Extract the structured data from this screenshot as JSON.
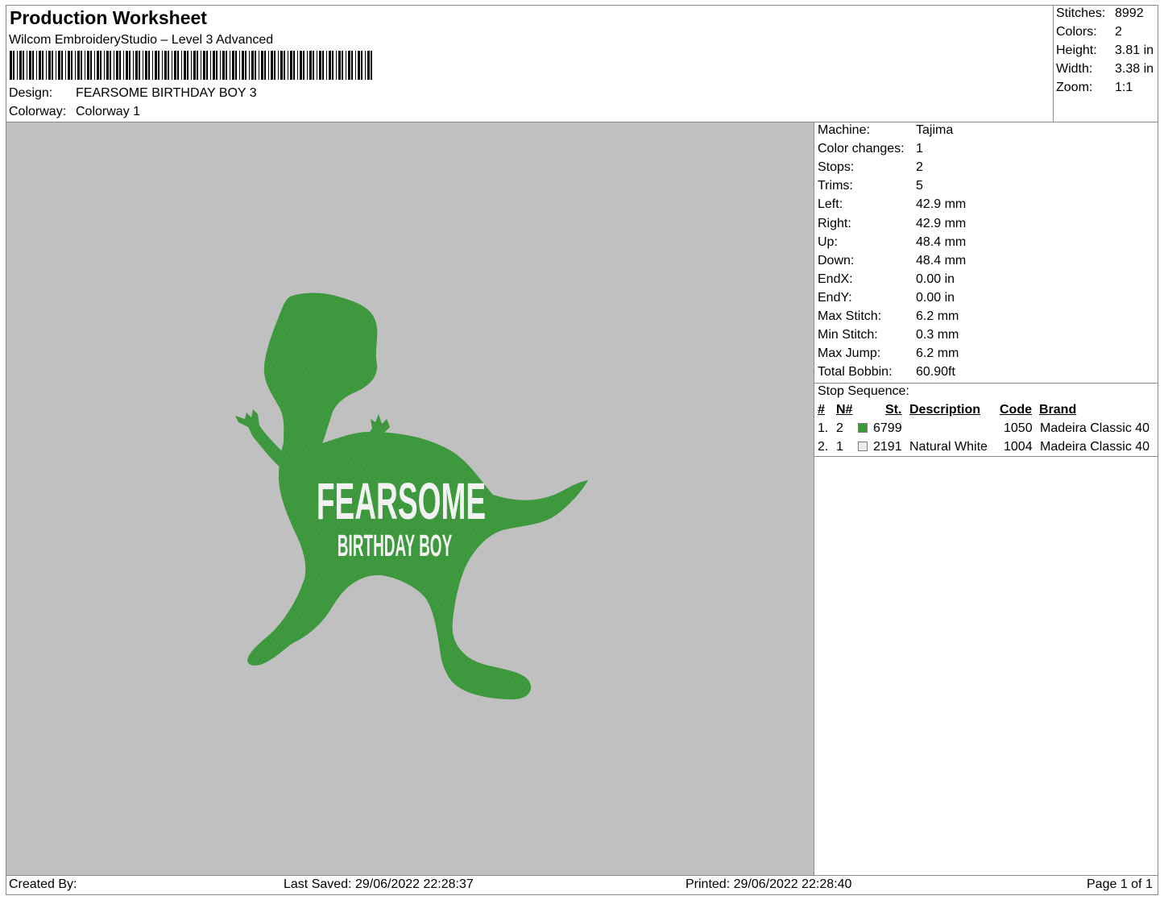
{
  "header": {
    "title": "Production Worksheet",
    "software": "Wilcom EmbroideryStudio – Level 3 Advanced",
    "design_label": "Design:",
    "design_value": "FEARSOME BIRTHDAY BOY 3",
    "colorway_label": "Colorway:",
    "colorway_value": "Colorway 1"
  },
  "stats": {
    "stitches_label": "Stitches:",
    "stitches": "8992",
    "colors_label": "Colors:",
    "colors": "2",
    "height_label": "Height:",
    "height": "3.81 in",
    "width_label": "Width:",
    "width": "3.38 in",
    "zoom_label": "Zoom:",
    "zoom": "1:1"
  },
  "machine_info": [
    {
      "label": "Machine:",
      "value": "Tajima"
    },
    {
      "label": "Color changes:",
      "value": "1"
    },
    {
      "label": "Stops:",
      "value": "2"
    },
    {
      "label": "Trims:",
      "value": "5"
    },
    {
      "label": "Left:",
      "value": "42.9 mm"
    },
    {
      "label": "Right:",
      "value": "42.9 mm"
    },
    {
      "label": "Up:",
      "value": "48.4 mm"
    },
    {
      "label": "Down:",
      "value": "48.4 mm"
    },
    {
      "label": "EndX:",
      "value": "0.00 in"
    },
    {
      "label": "EndY:",
      "value": "0.00 in"
    },
    {
      "label": "Max Stitch:",
      "value": "6.2 mm"
    },
    {
      "label": "Min Stitch:",
      "value": "0.3 mm"
    },
    {
      "label": "Max Jump:",
      "value": "6.2 mm"
    },
    {
      "label": "Total Bobbin:",
      "value": "60.90ft"
    }
  ],
  "stop_sequence": {
    "title": "Stop Sequence:",
    "headers": {
      "num": "#",
      "n": "N#",
      "st": "St.",
      "description": "Description",
      "code": "Code",
      "brand": "Brand"
    },
    "rows": [
      {
        "num": "1.",
        "n": "2",
        "swatch_color": "#3a9a3a",
        "st": "6799",
        "description": "",
        "code": "1050",
        "brand": "Madeira Classic 40"
      },
      {
        "num": "2.",
        "n": "1",
        "swatch_color": "#ececec",
        "st": "2191",
        "description": "Natural White",
        "code": "1004",
        "brand": "Madeira Classic 40"
      }
    ]
  },
  "design": {
    "text_line1": "FEARSOME",
    "text_line2": "BIRTHDAY BOY",
    "thread_green": "#3f9a3f",
    "thread_white": "#f2f2f2",
    "background": "#c0c0c0"
  },
  "footer": {
    "created_by": "Created By:",
    "last_saved": "Last Saved: 29/06/2022 22:28:37",
    "printed": "Printed: 29/06/2022 22:28:40",
    "page": "Page 1 of 1"
  }
}
